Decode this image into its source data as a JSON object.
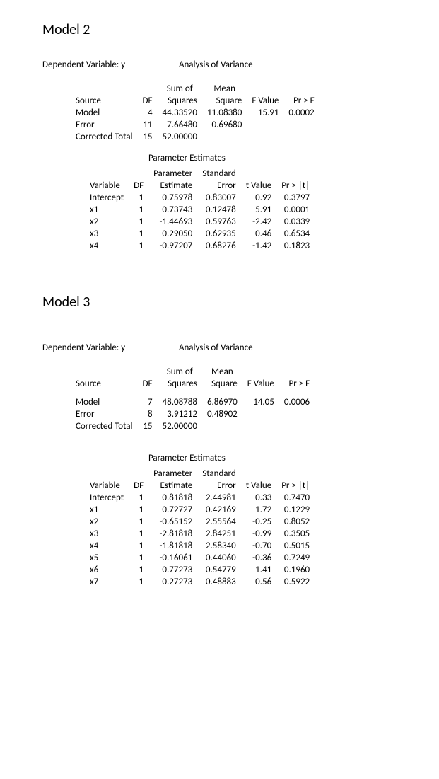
{
  "common": {
    "dep_label": "Dependent Variable: y",
    "aov_label": "Analysis of Variance",
    "param_label": "Parameter Estimates",
    "sumof": "Sum of",
    "mean": "Mean",
    "source": "Source",
    "df": "DF",
    "squares": "Squares",
    "square": "Square",
    "fvalue": "F Value",
    "prf": "Pr > F",
    "variable": "Variable",
    "parameter": "Parameter",
    "estimate": "Estimate",
    "standard": "Standard",
    "error": "Error",
    "tvalue": "t Value",
    "prt": "Pr > |t|",
    "model": "Model",
    "err": "Error",
    "ctotal": "Corrected Total"
  },
  "model2": {
    "title": "Model 2",
    "aov": {
      "model": {
        "df": "4",
        "ss": "44.33520",
        "ms": "11.08380",
        "f": "15.91",
        "p": "0.0002"
      },
      "error": {
        "df": "11",
        "ss": "7.66480",
        "ms": "0.69680"
      },
      "total": {
        "df": "15",
        "ss": "52.00000"
      }
    },
    "params": [
      {
        "var": "Intercept",
        "df": "1",
        "est": "0.75978",
        "se": "0.83007",
        "t": "0.92",
        "p": "0.3797"
      },
      {
        "var": "x1",
        "df": "1",
        "est": "0.73743",
        "se": "0.12478",
        "t": "5.91",
        "p": "0.0001"
      },
      {
        "var": "x2",
        "df": "1",
        "est": "-1.44693",
        "se": "0.59763",
        "t": "-2.42",
        "p": "0.0339"
      },
      {
        "var": "x3",
        "df": "1",
        "est": "0.29050",
        "se": "0.62935",
        "t": "0.46",
        "p": "0.6534"
      },
      {
        "var": "x4",
        "df": "1",
        "est": "-0.97207",
        "se": "0.68276",
        "t": "-1.42",
        "p": "0.1823"
      }
    ]
  },
  "model3": {
    "title": "Model 3",
    "aov": {
      "model": {
        "df": "7",
        "ss": "48.08788",
        "ms": "6.86970",
        "f": "14.05",
        "p": "0.0006"
      },
      "error": {
        "df": "8",
        "ss": "3.91212",
        "ms": "0.48902"
      },
      "total": {
        "df": "15",
        "ss": "52.00000"
      }
    },
    "params": [
      {
        "var": "Intercept",
        "df": "1",
        "est": "0.81818",
        "se": "2.44981",
        "t": "0.33",
        "p": "0.7470"
      },
      {
        "var": "x1",
        "df": "1",
        "est": "0.72727",
        "se": "0.42169",
        "t": "1.72",
        "p": "0.1229"
      },
      {
        "var": "x2",
        "df": "1",
        "est": "-0.65152",
        "se": "2.55564",
        "t": "-0.25",
        "p": "0.8052"
      },
      {
        "var": "x3",
        "df": "1",
        "est": "-2.81818",
        "se": "2.84251",
        "t": "-0.99",
        "p": "0.3505"
      },
      {
        "var": "x4",
        "df": "1",
        "est": "-1.81818",
        "se": "2.58340",
        "t": "-0.70",
        "p": "0.5015"
      },
      {
        "var": "x5",
        "df": "1",
        "est": "-0.16061",
        "se": "0.44060",
        "t": "-0.36",
        "p": "0.7249"
      },
      {
        "var": "x6",
        "df": "1",
        "est": "0.77273",
        "se": "0.54779",
        "t": "1.41",
        "p": "0.1960"
      },
      {
        "var": "x7",
        "df": "1",
        "est": "0.27273",
        "se": "0.48883",
        "t": "0.56",
        "p": "0.5922"
      }
    ]
  }
}
